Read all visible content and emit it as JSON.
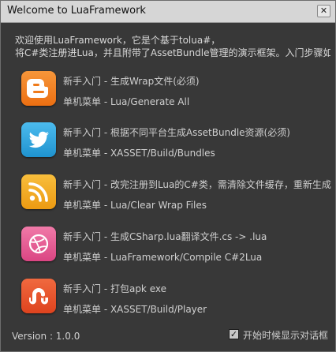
{
  "window": {
    "title": "Welcome to LuaFramework",
    "close_glyph": "✕"
  },
  "intro": {
    "line1": "欢迎使用LuaFramework，它是个基于tolua#，",
    "line2": "将C#类注册进Lua，并且附带了AssetBundle管理的演示框架。入门步骤如"
  },
  "items": [
    {
      "icon": "blogger-icon",
      "color": "#f07c1d",
      "line1": "新手入门 - 生成Wrap文件(必须)",
      "line2": "单机菜单 - Lua/Generate All"
    },
    {
      "icon": "twitter-icon",
      "color": "#2fa9e0",
      "line1": "新手入门 - 根据不同平台生成AssetBundle资源(必须)",
      "line2": "单机菜单 - XASSET/Build/Bundles"
    },
    {
      "icon": "rss-icon",
      "color": "#f2a81d",
      "line1": "新手入门 - 改完注册到Lua的C#类，需清除文件缓存，重新生成",
      "line2": "单机菜单 - Lua/Clear Wrap Files"
    },
    {
      "icon": "dribbble-icon",
      "color": "#e45a92",
      "line1": "新手入门 - 生成CSharp.lua翻译文件.cs -> .lua",
      "line2": "单机菜单 - LuaFramework/Compile C#2Lua"
    },
    {
      "icon": "stumbleupon-icon",
      "color": "#e8512b",
      "line1": "新手入门 - 打包apk exe",
      "line2": "单机菜单 - XASSET/Build/Player"
    }
  ],
  "footer": {
    "version": "Version : 1.0.0",
    "show_on_start_label": "开始时候显示对话框",
    "show_on_start_checked": true,
    "check_glyph": "✓"
  }
}
